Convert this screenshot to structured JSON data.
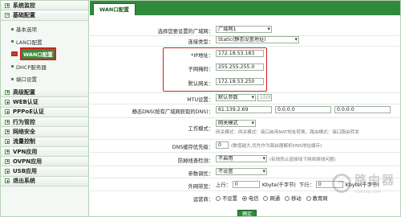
{
  "sidebar": {
    "groups": [
      {
        "label": "系统监控"
      },
      {
        "label": "基础配置"
      }
    ],
    "sub_items": [
      "基本选项",
      "LAN口配置",
      "WAN口配置",
      "DHCP服务器",
      "端口设置"
    ],
    "more_groups": [
      "高级配置",
      "WEB认证",
      "PPPoE认证",
      "行为管控",
      "网络安全",
      "流量控制",
      "VPN应用",
      "OVPN应用",
      "USB应用",
      "退出系统"
    ]
  },
  "tab": {
    "label": "WAN口配置"
  },
  "form": {
    "wan_select": {
      "label": "选择您要设置的广域网：",
      "value": "广域网1"
    },
    "conn_type": {
      "label": "连接类型：",
      "value": "Static(静态设置地址)"
    },
    "ip": {
      "label": "*IP地址：",
      "value": "172.18.53.183"
    },
    "mask": {
      "label": "子网掩码：",
      "value": "255.255.255.0"
    },
    "gateway": {
      "label": "默认网关：",
      "value": "172.18.53.250"
    },
    "mtu": {
      "label": "MTU设置：",
      "value": "默认参数",
      "extra": "1500"
    },
    "dns": {
      "label": "静态DNS(按有广域网获取的DNS)：",
      "dns1": "61.139.2.69",
      "dns2": "0.0.0.0",
      "dns3": "0.0.0.0"
    },
    "work_mode": {
      "label": "工作模式：",
      "value": "网关模式",
      "hint1": "网关模式：网关模式：接口启用NAT地址转换，路由模式：接口路由转发",
      "hint2": ""
    },
    "dns_cache": {
      "label": "DNS缓存优先级：",
      "value": "0",
      "hint": "(数值越大,优先作为路由器解析DNS地址缓存)"
    },
    "anti_drop": {
      "label": "防掉线查检测：",
      "value": "不启用",
      "hint": "(有效防止因掉线下网络掉线问题)"
    },
    "param_tune": {
      "label": "参数调优：",
      "value": "不设置"
    },
    "bandwidth": {
      "label": "外网带宽：",
      "up_label": "上行：",
      "up_value": "0",
      "up_unit": "Kbyte(千字节)",
      "down_label": "下行：",
      "down_value": "0",
      "down_unit": "Kbyte(千字节)"
    },
    "isp": {
      "label": "运营商：",
      "options": [
        "不设置",
        "电信",
        "网通",
        "移动",
        "教育网"
      ],
      "selected": 1
    }
  },
  "confirm_label": "确定",
  "watermark": {
    "title": "路由器",
    "url": "luyouqi.com"
  }
}
